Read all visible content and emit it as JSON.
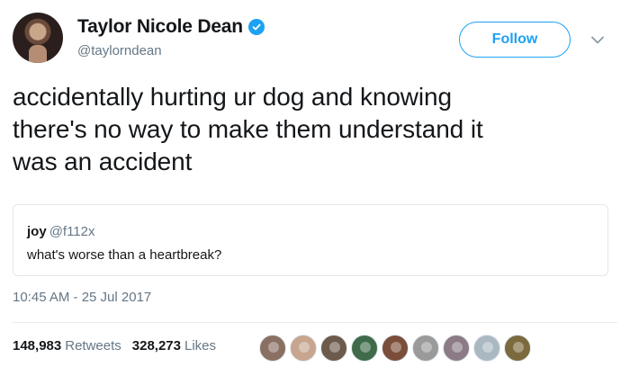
{
  "author": {
    "display_name": "Taylor Nicole Dean",
    "handle": "@taylorndean",
    "verified_icon": "verified-badge-icon"
  },
  "follow_label": "Follow",
  "tweet": {
    "line1": "accidentally hurting ur dog and knowing",
    "line2": "there's no way to make them understand it",
    "line3": "was an accident"
  },
  "quote": {
    "name": "joy",
    "handle": "@f112x",
    "text": "what's worse than a heartbreak?"
  },
  "timestamp": "10:45 AM - 25 Jul 2017",
  "stats": {
    "retweets_count": "148,983",
    "retweets_label": "Retweets",
    "likes_count": "328,273",
    "likes_label": "Likes"
  },
  "colors": {
    "accent": "#1da1f2",
    "text": "#14171a",
    "secondary": "#657786",
    "border": "#e1e8ed"
  },
  "likers": [
    {
      "name": "liker-avatar-1",
      "color": "#8a6f63"
    },
    {
      "name": "liker-avatar-2",
      "color": "#c7a58f"
    },
    {
      "name": "liker-avatar-3",
      "color": "#6c5a4c"
    },
    {
      "name": "liker-avatar-4",
      "color": "#3f6b4a"
    },
    {
      "name": "liker-avatar-5",
      "color": "#7a4e3a"
    },
    {
      "name": "liker-avatar-6",
      "color": "#9a9a9a"
    },
    {
      "name": "liker-avatar-7",
      "color": "#8c7b86"
    },
    {
      "name": "liker-avatar-8",
      "color": "#aab8c2"
    },
    {
      "name": "liker-avatar-9",
      "color": "#7c6a3f"
    }
  ]
}
